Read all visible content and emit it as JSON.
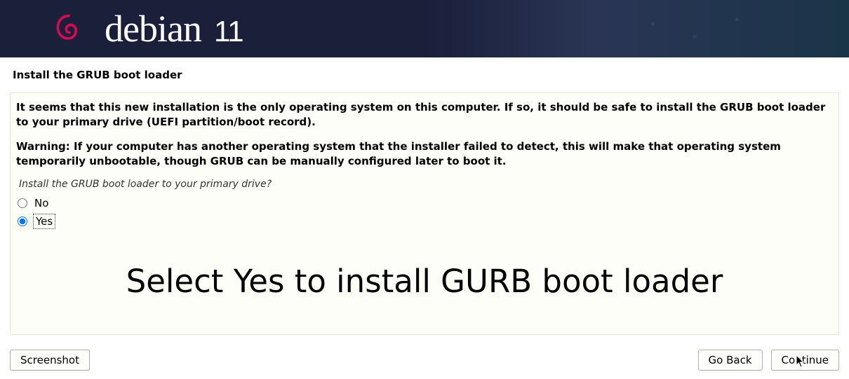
{
  "header": {
    "brand_name": "debian",
    "brand_version": "11"
  },
  "page": {
    "title": "Install the GRUB boot loader"
  },
  "panel": {
    "paragraph1": "It seems that this new installation is the only operating system on this computer. If so, it should be safe to install the GRUB boot loader to your primary drive (UEFI partition/boot record).",
    "paragraph2": "Warning: If your computer has another operating system that the installer failed to detect, this will make that operating system temporarily unbootable, though GRUB can be manually configured later to boot it.",
    "question": "Install the GRUB boot loader to your primary drive?",
    "options": {
      "no": {
        "label": "No",
        "checked": false
      },
      "yes": {
        "label": "Yes",
        "checked": true
      }
    },
    "overlay_caption": "Select Yes to install GURB boot loader"
  },
  "footer": {
    "screenshot_label": "Screenshot",
    "go_back_label": "Go Back",
    "continue_label": "Continue"
  }
}
